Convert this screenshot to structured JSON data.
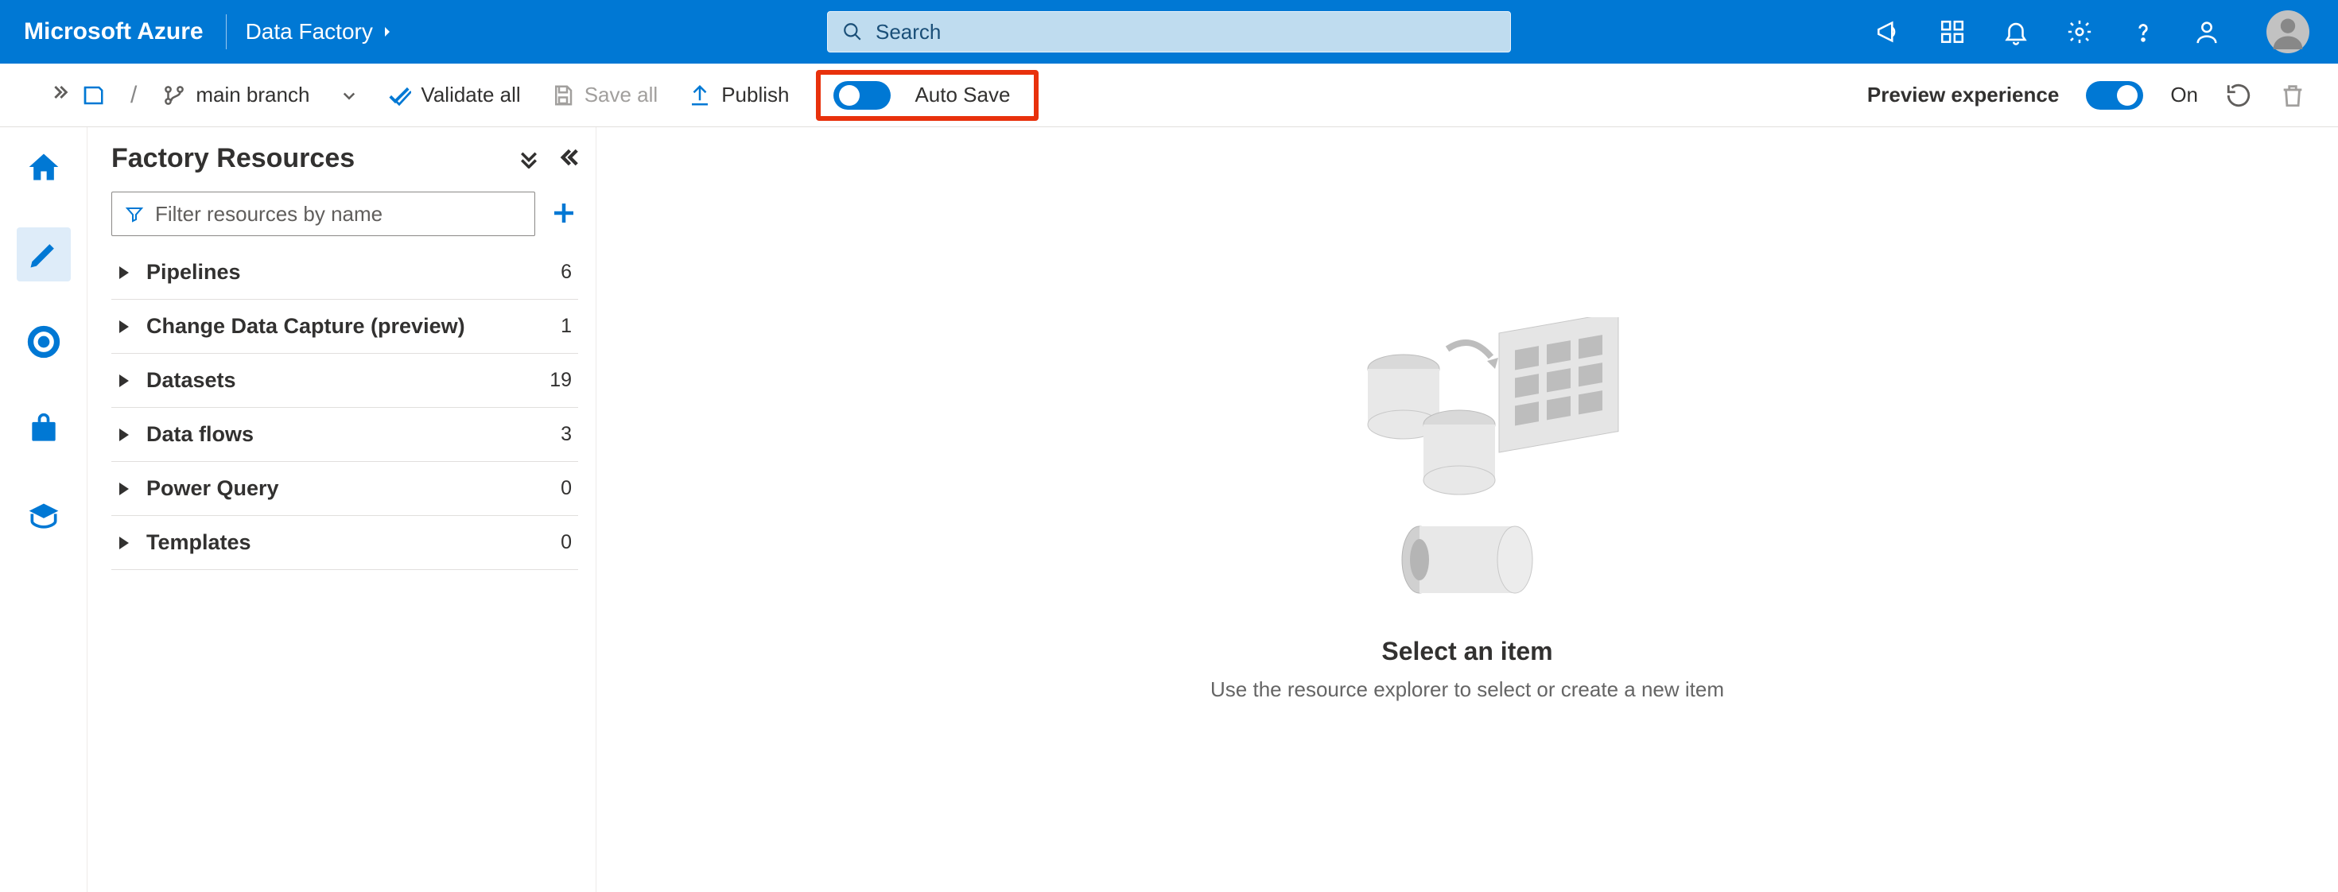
{
  "header": {
    "brand": "Microsoft Azure",
    "crumb": "Data Factory"
  },
  "search": {
    "placeholder": "Search"
  },
  "toolbar": {
    "branch": "main branch",
    "validate": "Validate all",
    "save_all": "Save all",
    "publish": "Publish",
    "auto_save": "Auto Save",
    "preview_label": "Preview experience",
    "preview_toggle": "On"
  },
  "panel": {
    "title": "Factory Resources",
    "filter_placeholder": "Filter resources by name",
    "items": [
      {
        "name": "Pipelines",
        "count": "6"
      },
      {
        "name": "Change Data Capture (preview)",
        "count": "1"
      },
      {
        "name": "Datasets",
        "count": "19"
      },
      {
        "name": "Data flows",
        "count": "3"
      },
      {
        "name": "Power Query",
        "count": "0"
      },
      {
        "name": "Templates",
        "count": "0"
      }
    ]
  },
  "empty": {
    "title": "Select an item",
    "sub": "Use the resource explorer to select or create a new item"
  }
}
